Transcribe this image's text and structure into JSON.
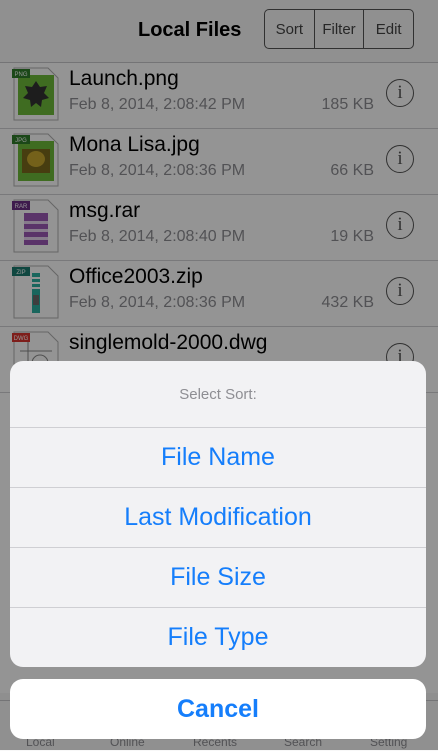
{
  "nav": {
    "title": "Local Files",
    "segments": [
      "Sort",
      "Filter",
      "Edit"
    ]
  },
  "files": [
    {
      "name": "Launch.png",
      "date": "Feb 8, 2014, 2:08:42 PM",
      "size": "185 KB",
      "badge": "PNG",
      "badge_color": "#6dbb3a"
    },
    {
      "name": "Mona Lisa.jpg",
      "date": "Feb 8, 2014, 2:08:36 PM",
      "size": "66 KB",
      "badge": "JPG",
      "badge_color": "#6dbb3a"
    },
    {
      "name": "msg.rar",
      "date": "Feb 8, 2014, 2:08:40 PM",
      "size": "19 KB",
      "badge": "RAR",
      "badge_color": "#8e4aa8"
    },
    {
      "name": "Office2003.zip",
      "date": "Feb 8, 2014, 2:08:36 PM",
      "size": "432 KB",
      "badge": "ZIP",
      "badge_color": "#2bb0a0"
    },
    {
      "name": "singlemold-2000.dwg",
      "date": "",
      "size": "",
      "badge": "DWG",
      "badge_color": "#d9352f"
    }
  ],
  "info_glyph": "i",
  "tabs": [
    "Local",
    "Online",
    "Recents",
    "Search",
    "Setting"
  ],
  "sheet": {
    "title": "Select Sort:",
    "options": [
      "File Name",
      "Last Modification",
      "File Size",
      "File Type"
    ],
    "cancel": "Cancel"
  },
  "colors": {
    "accent": "#157efb",
    "overlay": "rgba(0,0,0,0.42)"
  }
}
